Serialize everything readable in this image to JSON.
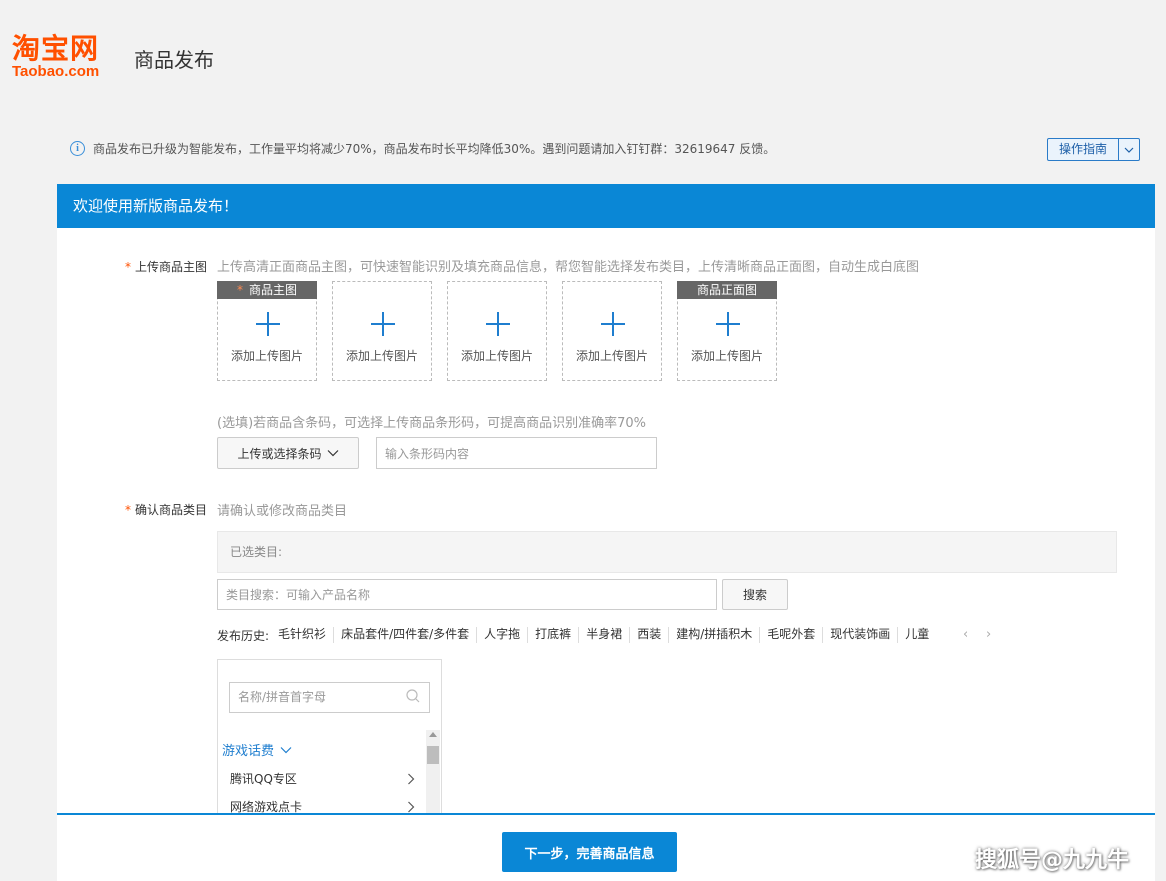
{
  "header": {
    "logo_cn": "淘宝网",
    "logo_en": "Taobao.com",
    "title": "商品发布"
  },
  "notice": {
    "icon": "info-icon",
    "text": "商品发布已升级为智能发布，工作量平均将减少70%，商品发布时长平均降低30%。遇到问题请加入钉钉群：32619647 反馈。"
  },
  "guide": {
    "label": "操作指南"
  },
  "banner": {
    "text": "欢迎使用新版商品发布！"
  },
  "main_image": {
    "required_mark": "*",
    "label": "上传商品主图",
    "hint": "上传高清正面商品主图，可快速智能识别及填充商品信息，帮您智能选择发布类目，上传清晰商品正面图，自动生成白底图",
    "slots": [
      {
        "tag": "商品主图",
        "tag_required": true,
        "text": "添加上传图片"
      },
      {
        "tag": "",
        "tag_required": false,
        "text": "添加上传图片"
      },
      {
        "tag": "",
        "tag_required": false,
        "text": "添加上传图片"
      },
      {
        "tag": "",
        "tag_required": false,
        "text": "添加上传图片"
      },
      {
        "tag": "商品正面图",
        "tag_required": false,
        "text": "添加上传图片"
      }
    ]
  },
  "barcode": {
    "hint": "(选填)若商品含条码，可选择上传商品条形码，可提高商品识别准确率70%",
    "button_label": "上传或选择条码",
    "input_placeholder": "输入条形码内容"
  },
  "category": {
    "required_mark": "*",
    "label": "确认商品类目",
    "hint": "请确认或修改商品类目",
    "selected_label": "已选类目:",
    "search_placeholder": "类目搜索：可输入产品名称",
    "search_button": "搜索",
    "history_label": "发布历史:",
    "history": [
      "毛针织衫",
      "床品套件/四件套/多件套",
      "人字拖",
      "打底裤",
      "半身裙",
      "西装",
      "建构/拼插积木",
      "毛呢外套",
      "现代装饰画",
      "儿童"
    ],
    "history_prev": "‹",
    "history_next": "›",
    "tree_search_placeholder": "名称/拼音首字母",
    "group": "游戏话费",
    "items": [
      "腾讯QQ专区",
      "网络游戏点卡"
    ]
  },
  "footer": {
    "next_button": "下一步，完善商品信息"
  },
  "watermark": "搜狐号@九九牛",
  "colors": {
    "brand": "#ff5000",
    "primary": "#0a87d6",
    "link": "#1f7ecf"
  }
}
